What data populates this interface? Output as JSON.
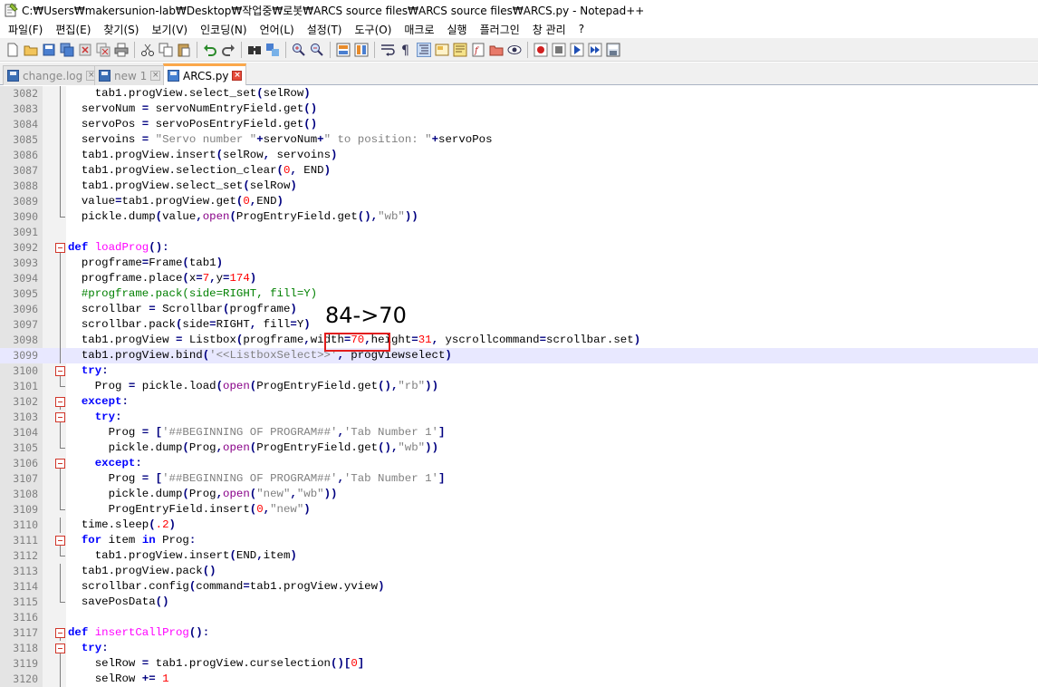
{
  "window": {
    "title": "C:₩Users₩makersunion-lab₩Desktop₩작업중₩로봇₩ARCS source files₩ARCS source files₩ARCS.py - Notepad++"
  },
  "menu": [
    {
      "label": "파일(F)"
    },
    {
      "label": "편집(E)"
    },
    {
      "label": "찾기(S)"
    },
    {
      "label": "보기(V)"
    },
    {
      "label": "인코딩(N)"
    },
    {
      "label": "언어(L)"
    },
    {
      "label": "설정(T)"
    },
    {
      "label": "도구(O)"
    },
    {
      "label": "매크로"
    },
    {
      "label": "실행"
    },
    {
      "label": "플러그인"
    },
    {
      "label": "창 관리"
    },
    {
      "label": "?"
    }
  ],
  "toolbar": {
    "icons": [
      "new-file-icon",
      "open-file-icon",
      "save-icon",
      "save-all-icon",
      "close-icon",
      "close-all-icon",
      "print-icon",
      "cut-icon",
      "copy-icon",
      "paste-icon",
      "undo-icon",
      "redo-icon",
      "find-icon",
      "replace-icon",
      "zoom-in-icon",
      "zoom-out-icon",
      "sync-vertical-icon",
      "sync-horizontal-icon",
      "word-wrap-icon",
      "show-all-chars-icon",
      "indent-guide-icon",
      "udl-icon",
      "doc-map-icon",
      "function-list-icon",
      "folder-workspace-icon",
      "monitoring-icon",
      "record-macro-icon",
      "stop-record-icon",
      "play-macro-icon",
      "run-macro-multiple-icon",
      "save-macro-icon"
    ]
  },
  "tabs": [
    {
      "label": "change.log",
      "active": false
    },
    {
      "label": "new 1",
      "active": false
    },
    {
      "label": "ARCS.py",
      "active": true
    }
  ],
  "annotation": {
    "label": "84->70"
  },
  "editor": {
    "current_line": "3099",
    "lines": [
      {
        "n": "3082",
        "t": "    tab1.progView.select_set(selRow)"
      },
      {
        "n": "3083",
        "t": "  servoNum = servoNumEntryField.get()"
      },
      {
        "n": "3084",
        "t": "  servoPos = servoPosEntryField.get()"
      },
      {
        "n": "3085",
        "t": "  servoins = \"Servo number \"+servoNum+\" to position: \"+servoPos"
      },
      {
        "n": "3086",
        "t": "  tab1.progView.insert(selRow, servoins)"
      },
      {
        "n": "3087",
        "t": "  tab1.progView.selection_clear(0, END)"
      },
      {
        "n": "3088",
        "t": "  tab1.progView.select_set(selRow)"
      },
      {
        "n": "3089",
        "t": "  value=tab1.progView.get(0,END)"
      },
      {
        "n": "3090",
        "t": "  pickle.dump(value,open(ProgEntryField.get(),\"wb\"))"
      },
      {
        "n": "3091",
        "t": ""
      },
      {
        "n": "3092",
        "t": "def loadProg():"
      },
      {
        "n": "3093",
        "t": "  progframe=Frame(tab1)"
      },
      {
        "n": "3094",
        "t": "  progframe.place(x=7,y=174)"
      },
      {
        "n": "3095",
        "t": "  #progframe.pack(side=RIGHT, fill=Y)"
      },
      {
        "n": "3096",
        "t": "  scrollbar = Scrollbar(progframe)"
      },
      {
        "n": "3097",
        "t": "  scrollbar.pack(side=RIGHT, fill=Y)"
      },
      {
        "n": "3098",
        "t": "  tab1.progView = Listbox(progframe,width=70,height=31, yscrollcommand=scrollbar.set)"
      },
      {
        "n": "3099",
        "t": "  tab1.progView.bind('<<ListboxSelect>>', progViewselect)"
      },
      {
        "n": "3100",
        "t": "  try:"
      },
      {
        "n": "3101",
        "t": "    Prog = pickle.load(open(ProgEntryField.get(),\"rb\"))"
      },
      {
        "n": "3102",
        "t": "  except:"
      },
      {
        "n": "3103",
        "t": "    try:"
      },
      {
        "n": "3104",
        "t": "      Prog = ['##BEGINNING OF PROGRAM##','Tab Number 1']"
      },
      {
        "n": "3105",
        "t": "      pickle.dump(Prog,open(ProgEntryField.get(),\"wb\"))"
      },
      {
        "n": "3106",
        "t": "    except:"
      },
      {
        "n": "3107",
        "t": "      Prog = ['##BEGINNING OF PROGRAM##','Tab Number 1']"
      },
      {
        "n": "3108",
        "t": "      pickle.dump(Prog,open(\"new\",\"wb\"))"
      },
      {
        "n": "3109",
        "t": "      ProgEntryField.insert(0,\"new\")"
      },
      {
        "n": "3110",
        "t": "  time.sleep(.2)"
      },
      {
        "n": "3111",
        "t": "  for item in Prog:"
      },
      {
        "n": "3112",
        "t": "    tab1.progView.insert(END,item)"
      },
      {
        "n": "3113",
        "t": "  tab1.progView.pack()"
      },
      {
        "n": "3114",
        "t": "  scrollbar.config(command=tab1.progView.yview)"
      },
      {
        "n": "3115",
        "t": "  savePosData()"
      },
      {
        "n": "3116",
        "t": ""
      },
      {
        "n": "3117",
        "t": "def insertCallProg():"
      },
      {
        "n": "3118",
        "t": "  try:"
      },
      {
        "n": "3119",
        "t": "    selRow = tab1.progView.curselection()[0]"
      },
      {
        "n": "3120",
        "t": "    selRow += 1"
      }
    ]
  }
}
